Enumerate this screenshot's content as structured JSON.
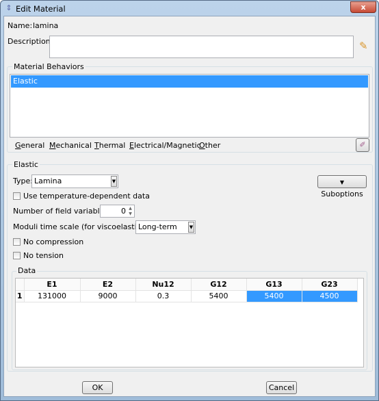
{
  "window": {
    "title": "Edit Material",
    "close_label": "x"
  },
  "name": {
    "label": "Name:",
    "value": "lamina"
  },
  "description": {
    "label": "Description:",
    "value": ""
  },
  "behaviors": {
    "group_label": "Material Behaviors",
    "items": [
      "Elastic"
    ],
    "selected": "Elastic"
  },
  "menu_tabs": [
    {
      "label": "General",
      "key": "G",
      "rest": "eneral"
    },
    {
      "label": "Mechanical",
      "key": "M",
      "rest": "echanical"
    },
    {
      "label": "Thermal",
      "key": "T",
      "rest": "hermal"
    },
    {
      "label": "Electrical/Magnetic",
      "key": "E",
      "rest": "lectrical/Magnetic"
    },
    {
      "label": "Other",
      "key": "O",
      "rest": "ther"
    }
  ],
  "elastic": {
    "group_label": "Elastic",
    "type_label": "Type:",
    "type_value": "Lamina",
    "suboptions_label": "Suboptions",
    "temp_dep_label": "Use temperature-dependent data",
    "temp_dep_checked": false,
    "field_vars_label": "Number of field variables:",
    "field_vars_value": "0",
    "moduli_label": "Moduli time scale (for viscoelasticity):",
    "moduli_value": "Long-term",
    "no_compression_label": "No compression",
    "no_compression_checked": false,
    "no_tension_label": "No tension",
    "no_tension_checked": false
  },
  "data": {
    "group_label": "Data",
    "columns": [
      "E1",
      "E2",
      "Nu12",
      "G12",
      "G13",
      "G23"
    ],
    "rows": [
      {
        "num": "1",
        "values": [
          "131000",
          "9000",
          "0.3",
          "5400",
          "5400",
          "4500"
        ]
      }
    ],
    "selected_columns": [
      "G13",
      "G23"
    ]
  },
  "buttons": {
    "ok": "OK",
    "cancel": "Cancel"
  },
  "colors": {
    "selection": "#3399ff",
    "dialog_bg": "#f0f0f0"
  }
}
